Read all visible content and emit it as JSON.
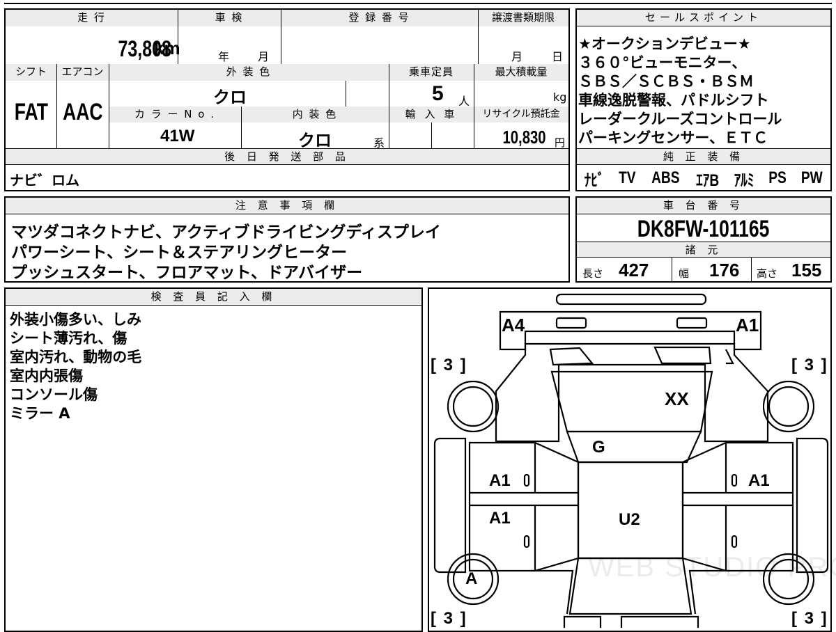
{
  "headers": {
    "mileage": "走 行",
    "inspection": "車 検",
    "registration_number": "登 録 番 号",
    "transfer_deadline": "譲渡書類期限",
    "sales_points": "セールスポイント",
    "shift": "シフト",
    "aircon": "エアコン",
    "exterior_color": "外 装 色",
    "capacity": "乗車定員",
    "max_load": "最大積載量",
    "color_no": "カ ラ ー N o .",
    "interior_color": "内 装 色",
    "import": "輸 入 車",
    "recycle_fee": "リサイクル預託金",
    "later_parts": "後 日 発 送 部 品",
    "genuine_equipment": "純 正 装 備",
    "notes": "注 意 事 項 欄",
    "chassis_number": "車 台 番 号",
    "specs": "諸 元",
    "inspector": "検 査 員 記 入 欄"
  },
  "vehicle": {
    "mileage": "73,808",
    "mileage_unit": "km",
    "inspection_year_unit": "年",
    "inspection_month_unit": "月",
    "deadline_month_unit": "月",
    "deadline_day_unit": "日",
    "shift": "FAT",
    "aircon": "AAC",
    "exterior_color": "クロ",
    "capacity": "5",
    "capacity_unit": "人",
    "load_unit": "kg",
    "color_no": "41W",
    "interior_color": "クロ",
    "interior_suffix": "系",
    "recycle_fee": "10,830",
    "recycle_unit": "円",
    "later_parts": "ナビ゛ロム",
    "chassis_number": "DK8FW-101165"
  },
  "sales_points": [
    "★オークションデビュー★",
    "３６０°ビューモニター、",
    "ＳＢＳ／ＳＣＢＳ・ＢＳＭ",
    "車線逸脱警報、パドルシフト",
    "レーダークルーズコントロール",
    "パーキングセンサー、ＥＴＣ"
  ],
  "equipment": [
    "ﾅﾋﾞ",
    "TV",
    "ABS",
    "ｴｱB",
    "ｱﾙﾐ",
    "PS",
    "PW"
  ],
  "notes": [
    "マツダコネクトナビ、アクティブドライビングディスプレイ",
    "パワーシート、シート＆ステアリングヒーター",
    "プッシュスタート、フロアマット、ドアバイザー"
  ],
  "specs": {
    "length_label": "長さ",
    "length": "427",
    "width_label": "幅",
    "width": "176",
    "height_label": "高さ",
    "height": "155"
  },
  "inspector_notes": [
    "外装小傷多い、しみ",
    "シート薄汚れ、傷",
    "室内汚れ、動物の毛",
    "室内内張傷",
    "コンソール傷",
    "ミラー A"
  ],
  "diagram": {
    "front_left": "A4",
    "front_right": "A1",
    "windshield": "XX",
    "dashboard": "G",
    "front_left_door": "A1",
    "front_right_door": "A1",
    "rear_left_door": "A1",
    "interior": "U2",
    "rear_left_tire": "A",
    "tire_marker": "[ 3 ]",
    "zero_mark": "0",
    "watermark": "WEB STUDIO PRO"
  }
}
